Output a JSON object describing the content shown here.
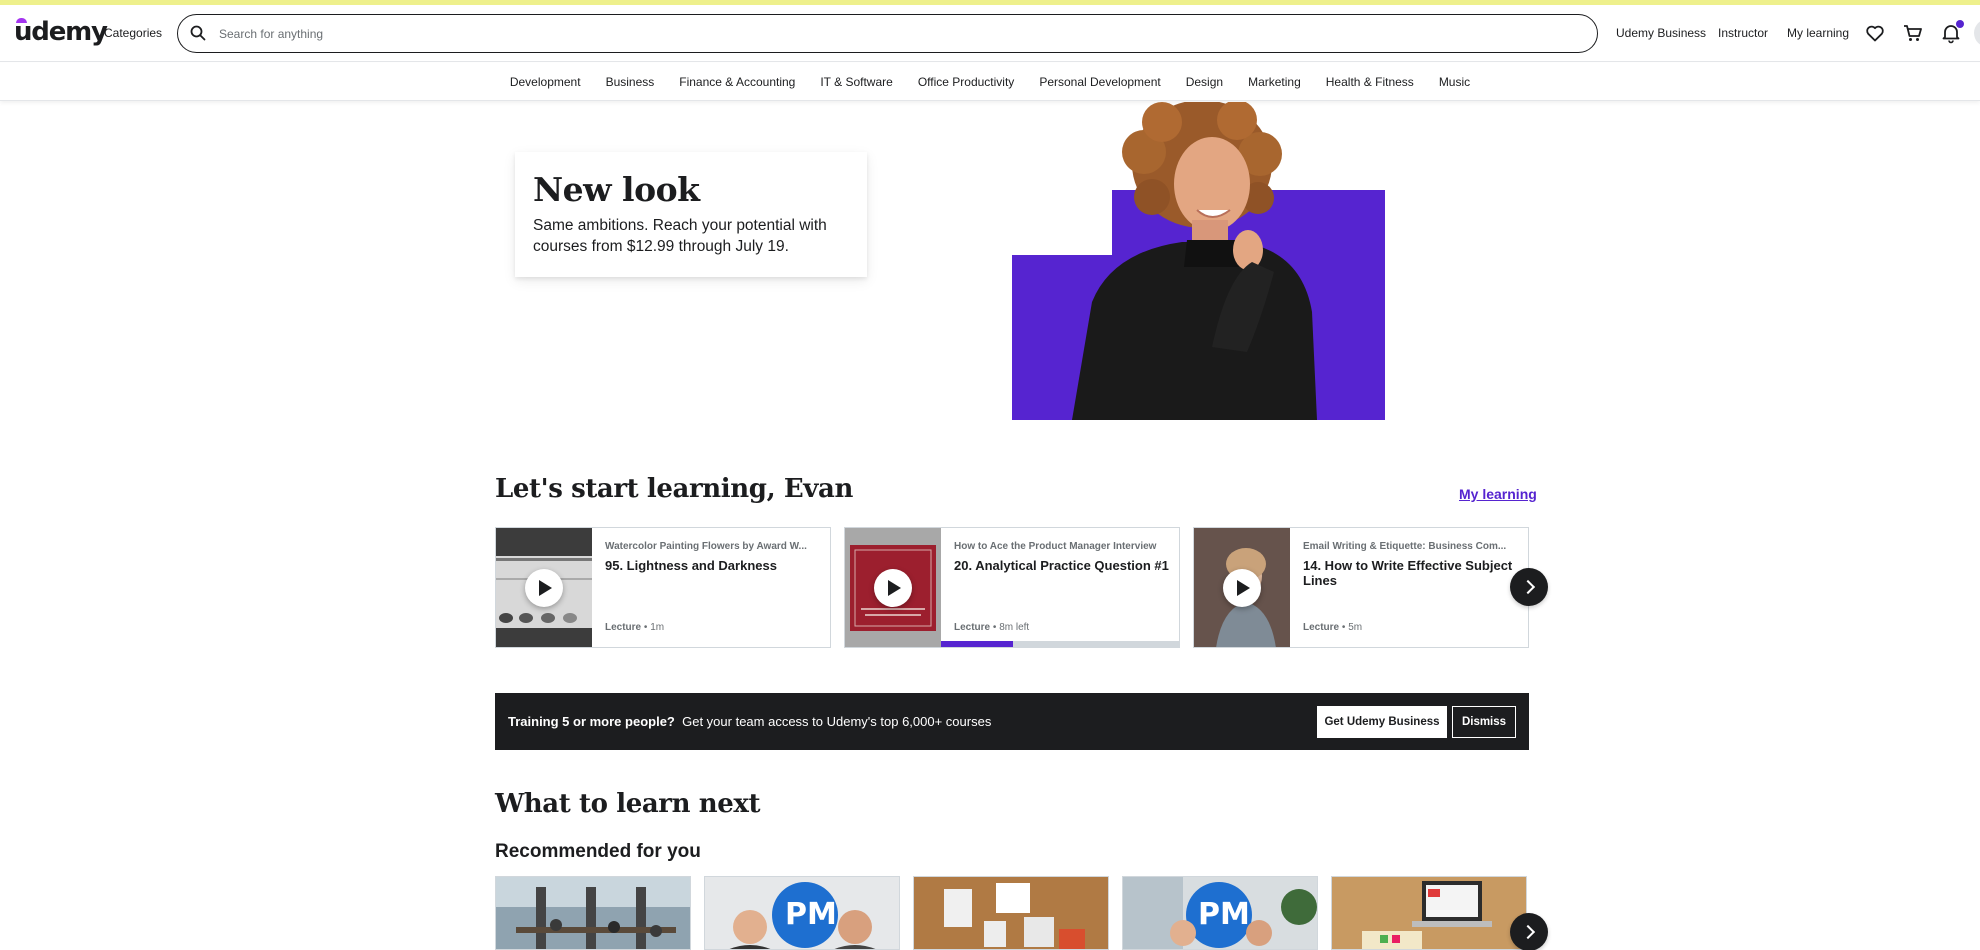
{
  "header": {
    "logo": "udemy",
    "categories_label": "Categories",
    "search_placeholder": "Search for anything",
    "nav": {
      "business": "Udemy Business",
      "instructor": "Instructor",
      "my_learning": "My learning"
    },
    "icons": [
      "heart-icon",
      "cart-icon",
      "bell-icon"
    ]
  },
  "category_bar": [
    "Development",
    "Business",
    "Finance & Accounting",
    "IT & Software",
    "Office Productivity",
    "Personal Development",
    "Design",
    "Marketing",
    "Health & Fitness",
    "Music"
  ],
  "hero": {
    "title": "New look",
    "subtitle": "Same ambitions. Reach your potential with courses from $12.99 through July 19."
  },
  "learning": {
    "title": "Let's start learning, Evan",
    "link": "My learning",
    "cards": [
      {
        "course": "Watercolor Painting Flowers by Award W...",
        "lecture": "95. Lightness and Darkness",
        "type": "Lecture",
        "duration": "1m",
        "progress": null
      },
      {
        "course": "How to Ace the Product Manager Interview",
        "lecture": "20. Analytical Practice Question #1",
        "type": "Lecture",
        "duration": "8m left",
        "progress": 0.3
      },
      {
        "course": "Email Writing & Etiquette: Business Com...",
        "lecture": "14. How to Write Effective Subject Lines",
        "type": "Lecture",
        "duration": "5m",
        "progress": null
      }
    ]
  },
  "banner": {
    "bold": "Training 5 or more people?",
    "text": "Get your team access to Udemy's top 6,000+ courses",
    "primary": "Get Udemy Business",
    "secondary": "Dismiss"
  },
  "next": {
    "title": "What to learn next",
    "subtitle": "Recommended for you",
    "badge": "PM"
  },
  "colors": {
    "accent": "#5624d0",
    "dark": "#1c1d1f",
    "top_strip": "#eef08c"
  }
}
